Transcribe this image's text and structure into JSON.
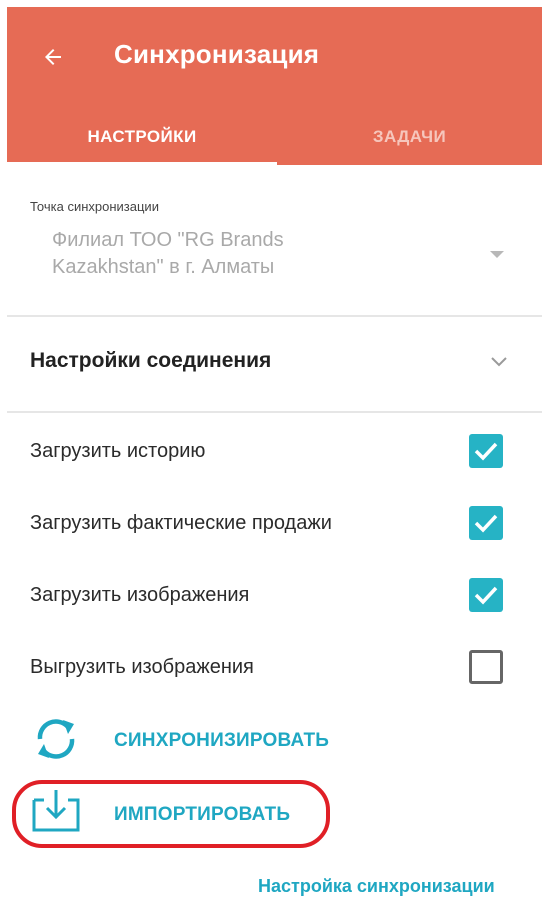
{
  "app": {
    "title": "Синхронизация",
    "back_icon": "arrow-left-icon"
  },
  "tabs": [
    {
      "label": "НАСТРОЙКИ",
      "active": true
    },
    {
      "label": "ЗАДАЧИ",
      "active": false
    }
  ],
  "sync_point": {
    "caption": "Точка синхронизации",
    "value_line1": "Филиал ТОО \"RG Brands",
    "value_line2": "Kazakhstan\"  в г. Алматы"
  },
  "connection_settings": {
    "title": "Настройки соединения",
    "expand_icon": "chevron-down-icon"
  },
  "options": [
    {
      "label": "Загрузить историю",
      "checked": true
    },
    {
      "label": "Загрузить фактические продажи",
      "checked": true
    },
    {
      "label": "Загрузить изображения",
      "checked": true
    },
    {
      "label": "Выгрузить изображения",
      "checked": false
    }
  ],
  "actions": {
    "sync_label": "СИНХРОНИЗИРОВАТЬ",
    "sync_icon": "sync-icon",
    "import_label": "ИМПОРТИРОВАТЬ",
    "import_icon": "import-icon"
  },
  "footer": {
    "settings_link": "Настройка синхронизации"
  },
  "colors": {
    "app_bar": "#e66b55",
    "accent": "#26b3c5",
    "link": "#1fa7c2",
    "highlight": "#e01f26"
  }
}
